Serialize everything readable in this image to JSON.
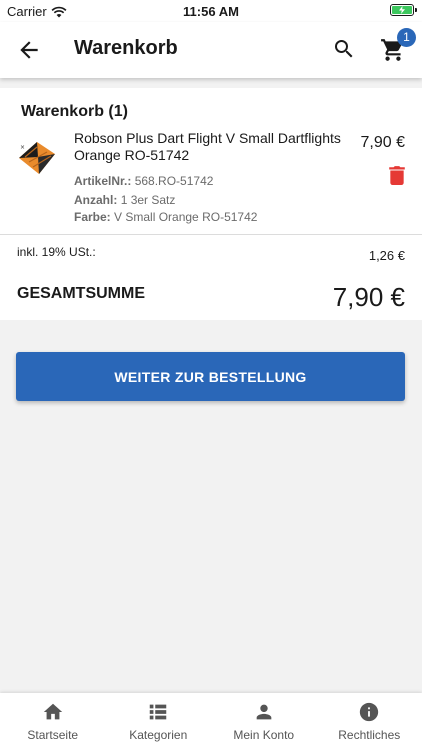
{
  "statusbar": {
    "carrier": "Carrier",
    "time": "11:56 AM"
  },
  "appbar": {
    "title": "Warenkorb",
    "cart_count": "1"
  },
  "cart": {
    "heading": "Warenkorb (1)",
    "item": {
      "name": "Robson Plus Dart Flight V Small Dartflights Orange RO-51742",
      "price": "7,90 €",
      "article_label": "ArtikelNr.:",
      "article_value": "568.RO-51742",
      "quantity_label": "Anzahl:",
      "quantity_value": "1 3er Satz",
      "color_label": "Farbe:",
      "color_value": "V Small Orange RO-51742"
    },
    "vat_label": "inkl. 19% USt.:",
    "vat_value": "1,26 €",
    "total_label": "GESAMTSUMME",
    "total_value": "7,90 €"
  },
  "checkout_button": "WEITER ZUR BESTELLUNG",
  "nav": [
    {
      "label": "Startseite",
      "icon": "home-icon"
    },
    {
      "label": "Kategorien",
      "icon": "list-icon"
    },
    {
      "label": "Mein Konto",
      "icon": "person-icon"
    },
    {
      "label": "Rechtliches",
      "icon": "info-icon"
    }
  ],
  "colors": {
    "accent": "#2a67b8",
    "delete": "#e53935",
    "battery": "#3cc75e"
  }
}
